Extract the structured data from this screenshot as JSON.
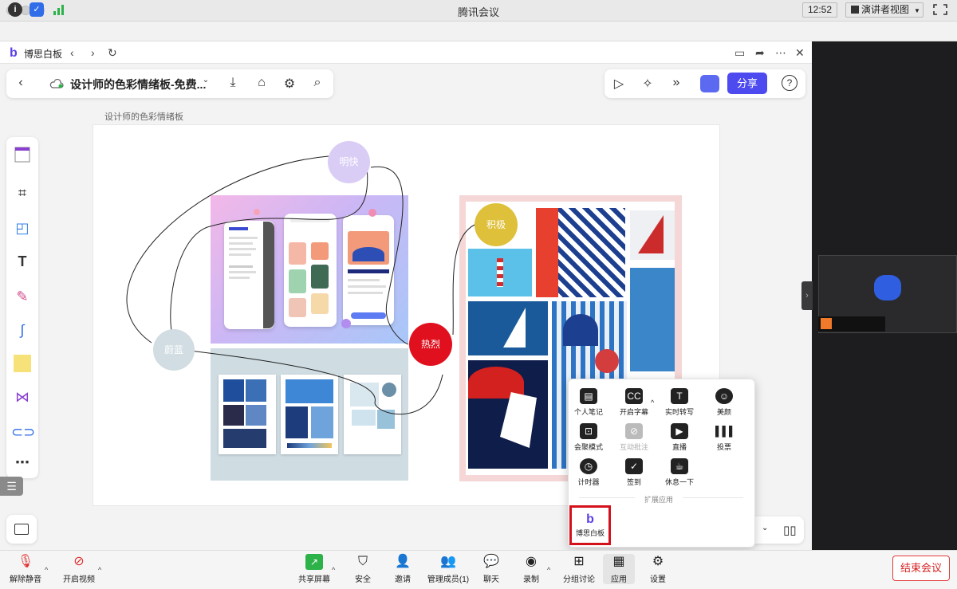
{
  "window": {
    "title": "腾讯会议"
  },
  "infobar": {
    "clock": "12:52",
    "view_mode": "演讲者视图"
  },
  "whiteboard": {
    "app_name": "博思白板",
    "logo": "b",
    "doc_title": "设计师的色彩情绪板-免费...",
    "board_label": "设计师的色彩情绪板",
    "share_label": "分享",
    "nodes": {
      "bright": "明快",
      "azure": "蔚蓝",
      "hot": "热烈",
      "positive": "积极"
    }
  },
  "apps_popup": {
    "items": [
      {
        "label": "个人笔记",
        "icon": "notebook-icon",
        "enabled": true
      },
      {
        "label": "开启字幕",
        "icon": "captions-icon",
        "enabled": true
      },
      {
        "label": "实时转写",
        "icon": "transcribe-icon",
        "enabled": true
      },
      {
        "label": "美颜",
        "icon": "beauty-icon",
        "enabled": true
      },
      {
        "label": "会聚模式",
        "icon": "gather-mode-icon",
        "enabled": true
      },
      {
        "label": "互动批注",
        "icon": "annotate-icon",
        "enabled": false
      },
      {
        "label": "直播",
        "icon": "live-icon",
        "enabled": true
      },
      {
        "label": "投票",
        "icon": "poll-icon",
        "enabled": true
      },
      {
        "label": "计时器",
        "icon": "timer-icon",
        "enabled": true
      },
      {
        "label": "签到",
        "icon": "checkin-icon",
        "enabled": true
      },
      {
        "label": "休息一下",
        "icon": "coffee-icon",
        "enabled": true
      }
    ],
    "section_label": "扩展应用",
    "extension": {
      "label": "博思白板",
      "icon": "boardmix-icon"
    }
  },
  "bottombar": {
    "unmute": "解除静音",
    "start_video": "开启视频",
    "share_screen": "共享屏幕",
    "security": "安全",
    "invite": "邀请",
    "members": "管理成员(1)",
    "chat": "聊天",
    "record": "录制",
    "breakout": "分组讨论",
    "apps": "应用",
    "settings": "设置",
    "end_meeting": "结束会议"
  },
  "colors": {
    "accent": "#4d4bf0",
    "end": "#d61f1f",
    "hot_node": "#e0101e",
    "positive_node": "#dfc03a",
    "bright_node": "#d9cdf6",
    "azure_node": "#d1dde2"
  }
}
